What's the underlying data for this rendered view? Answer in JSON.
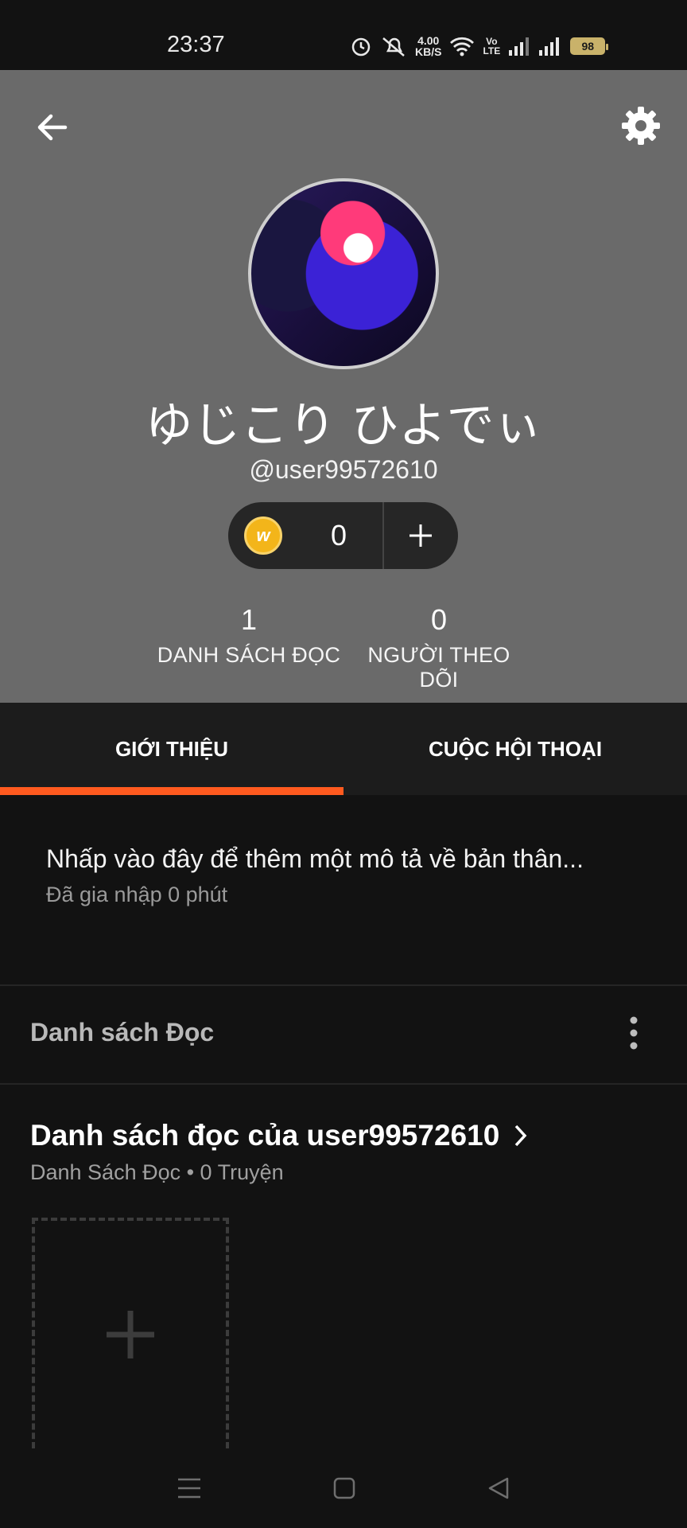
{
  "status_bar": {
    "time": "23:37",
    "speed_value": "4.00",
    "speed_unit": "KB/S",
    "volte_line1": "Vo",
    "volte_line2": "LTE",
    "battery": "98"
  },
  "profile": {
    "display_name": "ゆじこり ひよでぃ",
    "username": "@user99572610",
    "coins": "0"
  },
  "stats": [
    {
      "value": "1",
      "label": "DANH SÁCH ĐỌC"
    },
    {
      "value": "0",
      "label": "NGƯỜI THEO DÕI"
    }
  ],
  "tabs": [
    {
      "label": "GIỚI THIỆU",
      "active": true
    },
    {
      "label": "CUỘC HỘI THOẠI",
      "active": false
    }
  ],
  "about": {
    "description_prompt": "Nhấp vào đây để thêm một mô tả về bản thân...",
    "joined": "Đã gia nhập 0 phút"
  },
  "reading_lists": {
    "section_title": "Danh sách Đọc",
    "list_title": "Danh sách đọc của user99572610",
    "list_meta": "Danh Sách Đọc • 0 Truyện"
  },
  "colors": {
    "header_bg": "#6a6a6a",
    "accent": "#ff5a1f",
    "coin": "#f3b51a",
    "page_bg": "#121212"
  },
  "icons": [
    "back-arrow-icon",
    "gear-icon",
    "coin-icon",
    "plus-icon",
    "chevron-right-icon",
    "kebab-menu-icon",
    "menu-icon",
    "home-square-icon",
    "back-triangle-icon"
  ]
}
